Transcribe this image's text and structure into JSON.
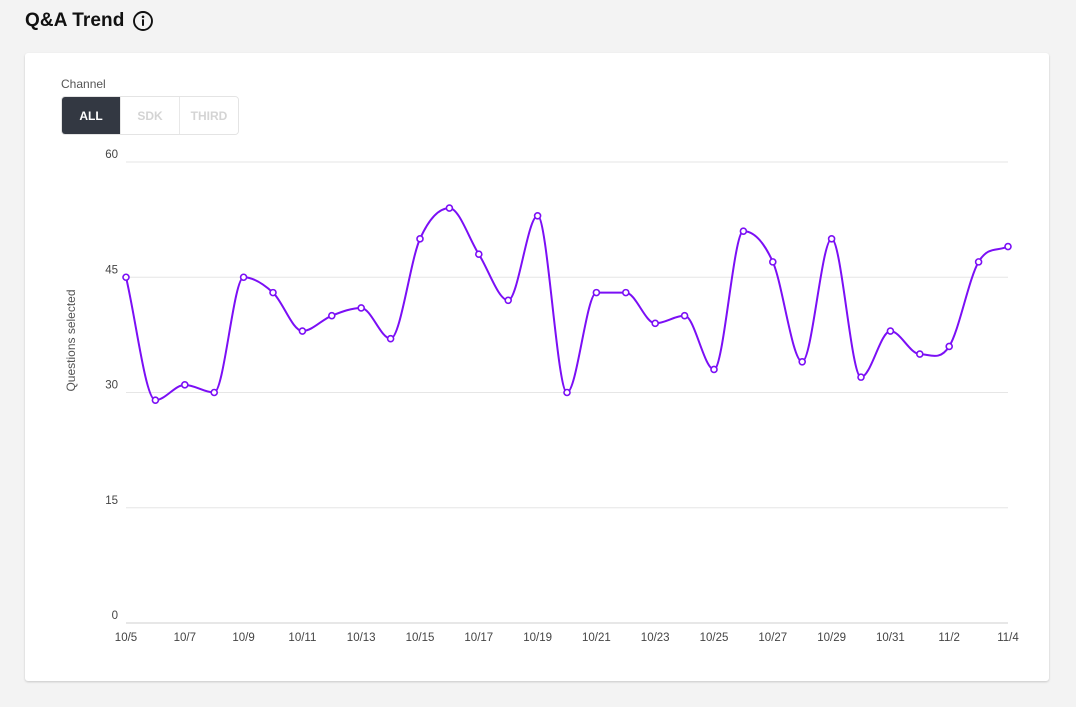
{
  "header": {
    "title": "Q&A Trend",
    "icon": "info-icon"
  },
  "filter": {
    "label": "Channel",
    "options": [
      "ALL",
      "SDK",
      "THIRD"
    ],
    "selected": "ALL"
  },
  "colors": {
    "line": "#7b0ff5",
    "grid": "#e6e6e6",
    "active_button": "#333842"
  },
  "chart_data": {
    "type": "line",
    "x": [
      "10/5",
      "10/6",
      "10/7",
      "10/8",
      "10/9",
      "10/10",
      "10/11",
      "10/12",
      "10/13",
      "10/14",
      "10/15",
      "10/16",
      "10/17",
      "10/18",
      "10/19",
      "10/20",
      "10/21",
      "10/22",
      "10/23",
      "10/24",
      "10/25",
      "10/26",
      "10/27",
      "10/28",
      "10/29",
      "10/30",
      "10/31",
      "11/1",
      "11/2",
      "11/3",
      "11/4"
    ],
    "values": [
      45,
      29,
      31,
      30,
      45,
      43,
      38,
      40,
      41,
      37,
      50,
      54,
      48,
      42,
      53,
      30,
      43,
      43,
      39,
      40,
      33,
      51,
      47,
      34,
      50,
      32,
      38,
      35,
      36,
      47,
      49
    ],
    "xtick_labels": [
      "10/5",
      "10/7",
      "10/9",
      "10/11",
      "10/13",
      "10/15",
      "10/17",
      "10/19",
      "10/21",
      "10/23",
      "10/25",
      "10/27",
      "10/29",
      "10/31",
      "11/2",
      "11/4"
    ],
    "yticks": [
      0,
      15,
      30,
      45,
      60
    ],
    "ylim": [
      0,
      60
    ],
    "ylabel": "Questions selected",
    "xlabel": "",
    "grid": true,
    "smooth": true,
    "markers": "hollow-circle"
  }
}
